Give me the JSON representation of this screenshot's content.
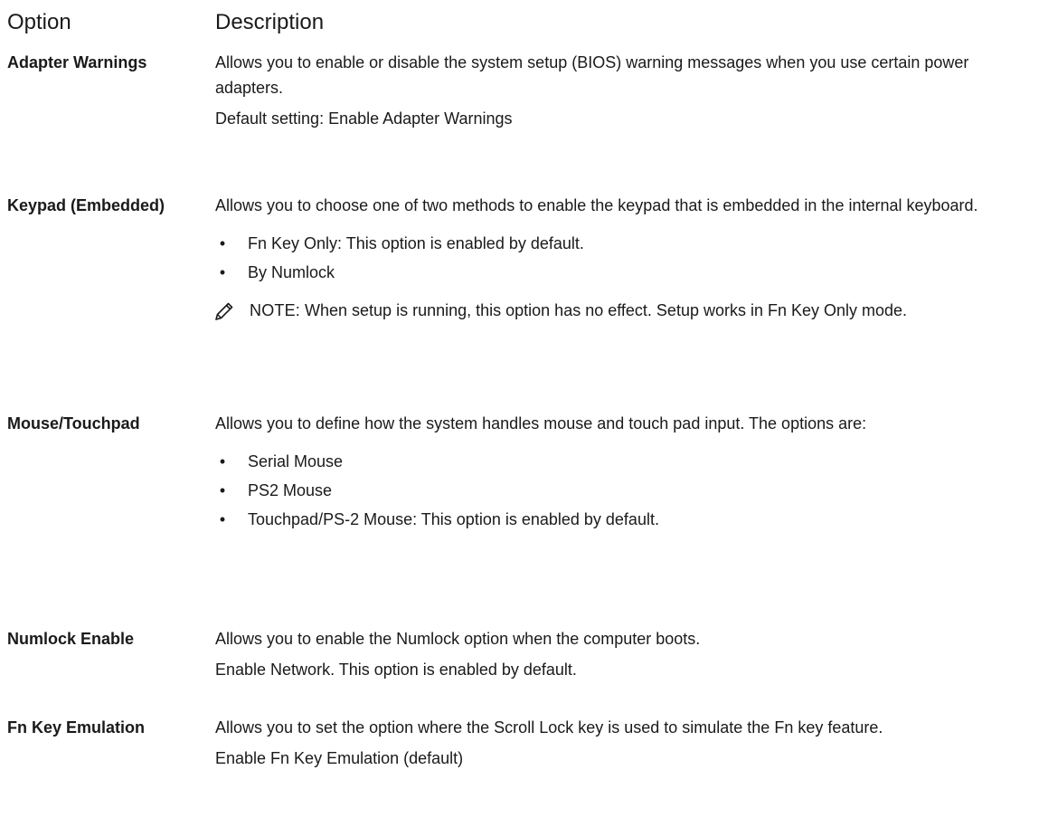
{
  "header": {
    "option": "Option",
    "description": "Description"
  },
  "rows": [
    {
      "name": "Adapter Warnings",
      "desc": "Allows you to enable or disable the system setup (BIOS) warning messages when you use certain power adapters.",
      "extra": "Default setting: Enable Adapter Warnings"
    },
    {
      "name": "Keypad (Embedded)",
      "desc": "Allows you to choose one of two methods to enable the keypad that is embedded in the internal keyboard.",
      "bullets": [
        "Fn Key Only: This option is enabled by default.",
        "By Numlock"
      ],
      "note_label": "NOTE:",
      "note_text": " When setup is running, this option has no effect. Setup works in Fn Key Only mode."
    },
    {
      "name": "Mouse/Touchpad",
      "desc": "Allows you to define how the system handles mouse and touch pad input. The options are:",
      "bullets": [
        "Serial Mouse",
        "PS2 Mouse",
        "Touchpad/PS-2 Mouse: This option is enabled by default."
      ]
    },
    {
      "name": "Numlock Enable",
      "desc": "Allows you to enable the Numlock option when the computer boots.",
      "extra": "Enable Network. This option is enabled by default."
    },
    {
      "name": "Fn Key Emulation",
      "desc": "Allows you to set the option where the Scroll Lock key is used to simulate the Fn key feature.",
      "extra": "Enable Fn Key Emulation (default)"
    }
  ],
  "icons": {
    "note": "pencil-note-icon"
  },
  "colors": {
    "text": "#1a1a1a",
    "background": "#ffffff"
  }
}
